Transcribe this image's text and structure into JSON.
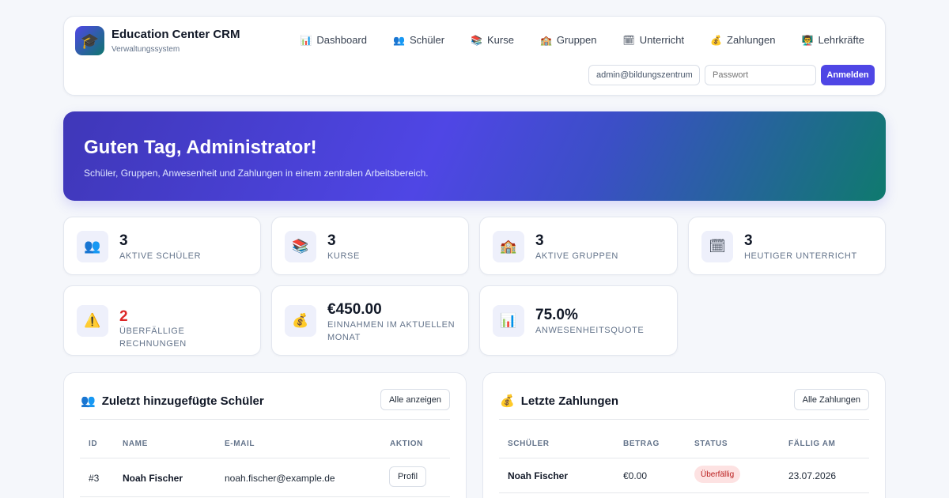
{
  "app": {
    "title": "Education Center CRM",
    "subtitle": "Verwaltungssystem",
    "logo_icon": "graduation-cap"
  },
  "nav": [
    {
      "label": "Dashboard",
      "icon": "📊"
    },
    {
      "label": "Schüler",
      "icon": "👥"
    },
    {
      "label": "Kurse",
      "icon": "📚"
    },
    {
      "label": "Gruppen",
      "icon": "🏫"
    },
    {
      "label": "Unterricht",
      "icon": "🗓"
    },
    {
      "label": "Zahlungen",
      "icon": "💰"
    },
    {
      "label": "Lehrkräfte",
      "icon": "👨‍🏫"
    }
  ],
  "login": {
    "email_value": "admin@bildungszentrum",
    "password_placeholder": "Passwort",
    "submit_label": "Anmelden"
  },
  "hero": {
    "title": "Guten Tag, Administrator!",
    "subtitle": "Schüler, Gruppen, Anwesenheit und Zahlungen in einem zentralen Arbeitsbereich."
  },
  "stats": [
    {
      "value": "3",
      "label": "Aktive Schüler",
      "icon": "👥"
    },
    {
      "value": "3",
      "label": "Kurse",
      "icon": "📚"
    },
    {
      "value": "3",
      "label": "Aktive Gruppen",
      "icon": "🏫"
    },
    {
      "value": "3",
      "label": "Heutiger Unterricht",
      "icon": "🗓"
    },
    {
      "value": "2",
      "label": "Überfällige Rechnungen",
      "icon": "⚠️"
    },
    {
      "value": "€450.00",
      "label": "Einnahmen im aktuellen Monat",
      "icon": "💰"
    },
    {
      "value": "75.0%",
      "label": "Anwesenheitsquote",
      "icon": "📊"
    }
  ],
  "students_panel": {
    "title": "Zuletzt hinzugefügte Schüler",
    "icon": "👥",
    "button": "Alle anzeigen",
    "columns": [
      "ID",
      "Name",
      "E-Mail",
      "Aktion"
    ],
    "rows": [
      {
        "id": "#3",
        "name": "Noah Fischer",
        "email": "noah.fischer@example.de",
        "action": "Profil"
      }
    ]
  },
  "payments_panel": {
    "title": "Letzte Zahlungen",
    "icon": "💰",
    "button": "Alle Zahlungen",
    "columns": [
      "Schüler",
      "Betrag",
      "Status",
      "Fällig am"
    ],
    "rows": [
      {
        "student": "Noah Fischer",
        "amount": "€0.00",
        "status": "Überfällig",
        "due": "23.07.2026"
      }
    ]
  },
  "colors": {
    "accent": "#4f46e5",
    "danger": "#dc2626",
    "hero_end": "#0f7a6e"
  }
}
